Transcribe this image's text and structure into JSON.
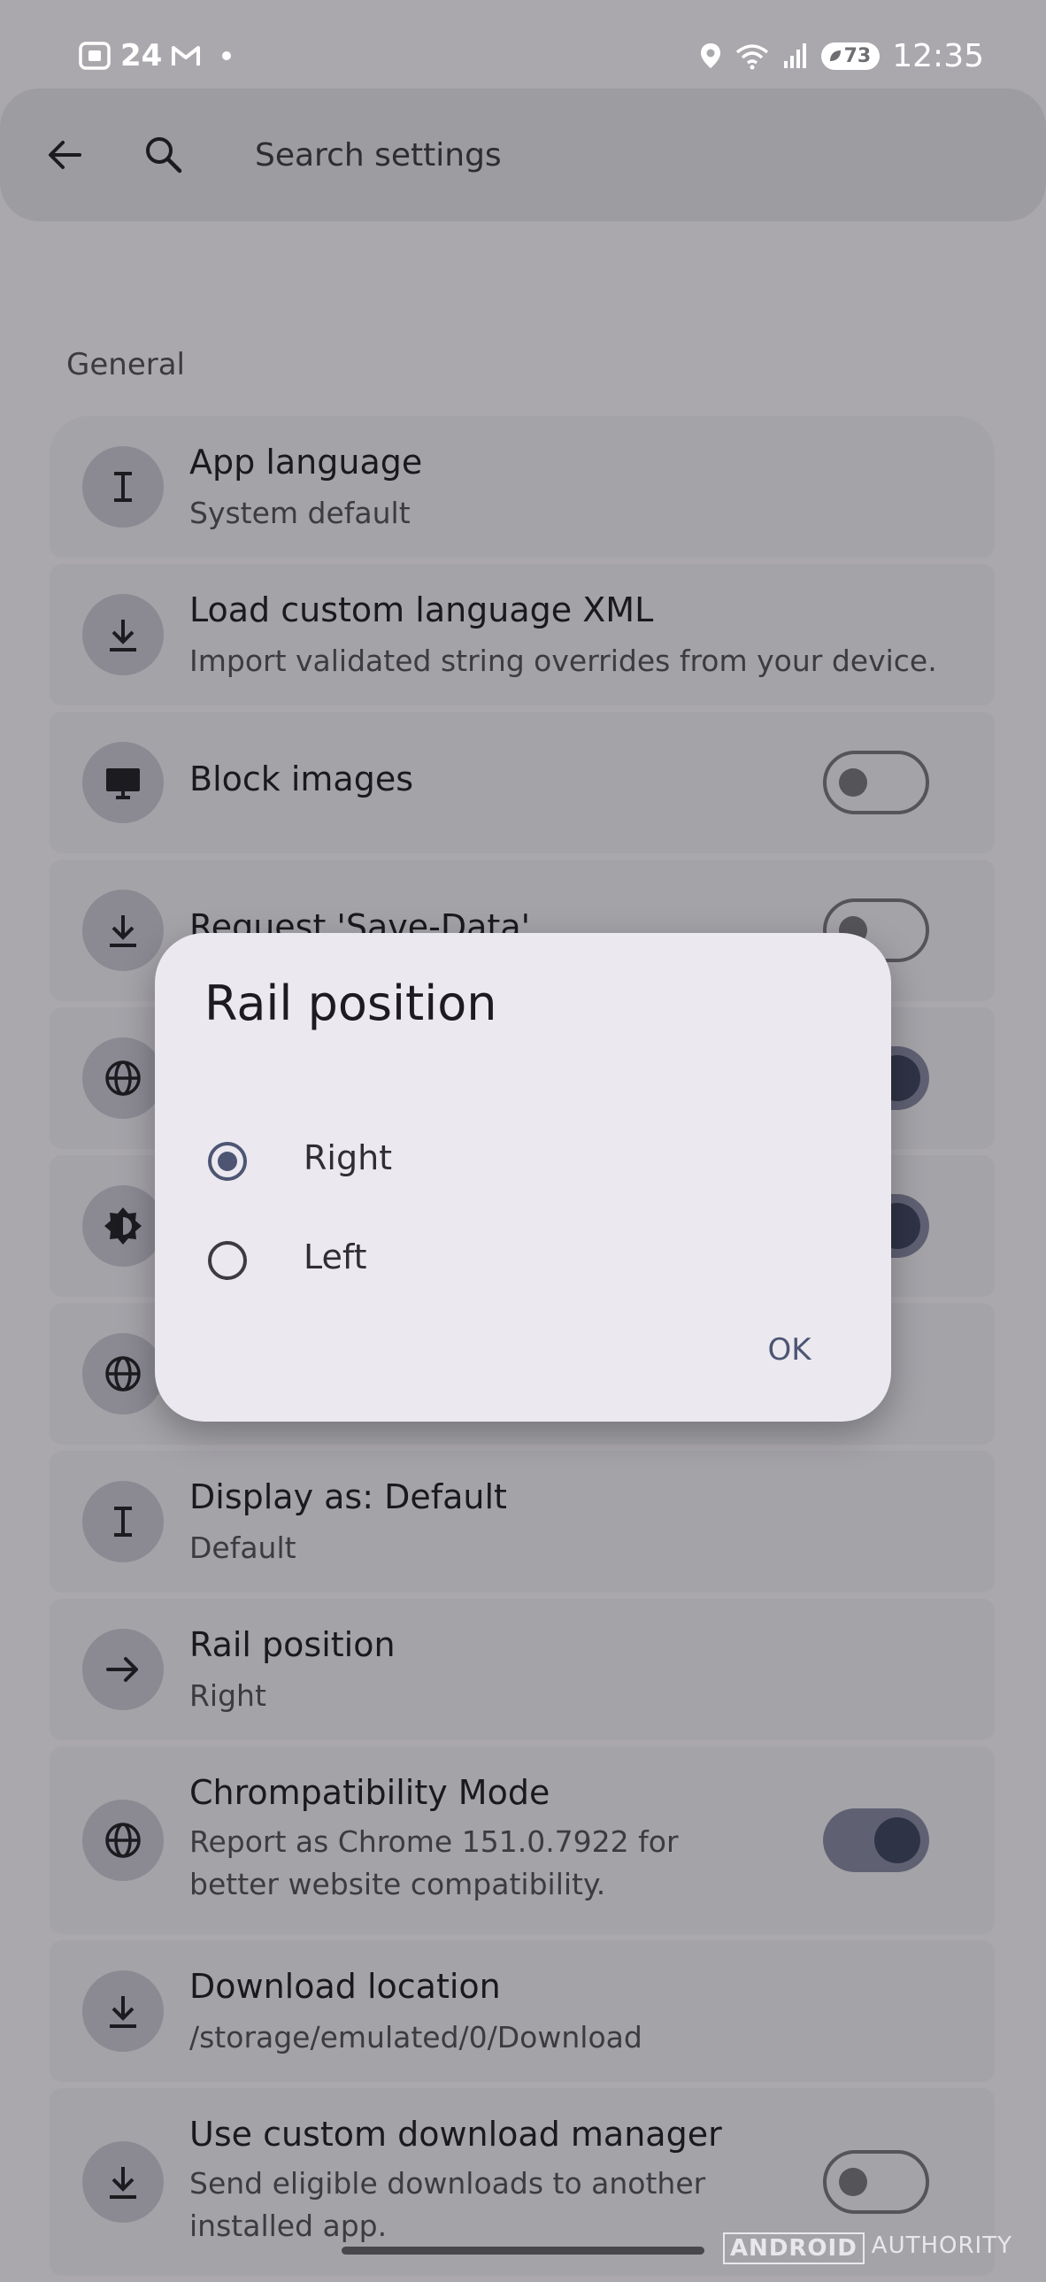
{
  "status_bar": {
    "time": "12:35",
    "battery": "73",
    "left_label": "24",
    "left_icons": [
      "screenshot-icon",
      "gmail-icon"
    ],
    "right_icons": [
      "location-icon",
      "wifi-icon",
      "signal-icon"
    ]
  },
  "search": {
    "placeholder": "Search settings"
  },
  "section": {
    "title": "General"
  },
  "settings": [
    {
      "icon": "text-icon",
      "title": "App language",
      "subtitle": "System default",
      "toggle": null
    },
    {
      "icon": "download-icon",
      "title": "Load custom language XML",
      "subtitle": "Import validated string overrides from your device.",
      "toggle": null
    },
    {
      "icon": "monitor-icon",
      "title": "Block images",
      "subtitle": "",
      "toggle": false
    },
    {
      "icon": "download-icon",
      "title": "Request 'Save-Data'",
      "subtitle": "",
      "toggle": false
    },
    {
      "icon": "globe-icon",
      "title": "",
      "subtitle": "",
      "toggle": true
    },
    {
      "icon": "brightness-icon",
      "title": "",
      "subtitle": "",
      "toggle": true
    },
    {
      "icon": "globe-icon",
      "title": "",
      "subtitle": "",
      "toggle": null
    },
    {
      "icon": "text-icon",
      "title": "Display as: Default",
      "subtitle": "Default",
      "toggle": null
    },
    {
      "icon": "arrow-right-icon",
      "title": "Rail position",
      "subtitle": "Right",
      "toggle": null
    },
    {
      "icon": "globe-icon",
      "title": "Chrompatibility Mode",
      "subtitle": "Report as Chrome 151.0.7922 for better website compatibility.",
      "toggle": true
    },
    {
      "icon": "download-icon",
      "title": "Download location",
      "subtitle": "/storage/emulated/0/Download",
      "toggle": null
    },
    {
      "icon": "download-icon",
      "title": "Use custom download manager",
      "subtitle": "Send eligible downloads to another installed app.",
      "toggle": false
    }
  ],
  "dialog": {
    "title": "Rail position",
    "options": [
      {
        "label": "Right",
        "selected": true
      },
      {
        "label": "Left",
        "selected": false
      }
    ],
    "ok_label": "OK"
  },
  "watermark": {
    "part1": "ANDROID",
    "part2": "AUTHORITY"
  }
}
